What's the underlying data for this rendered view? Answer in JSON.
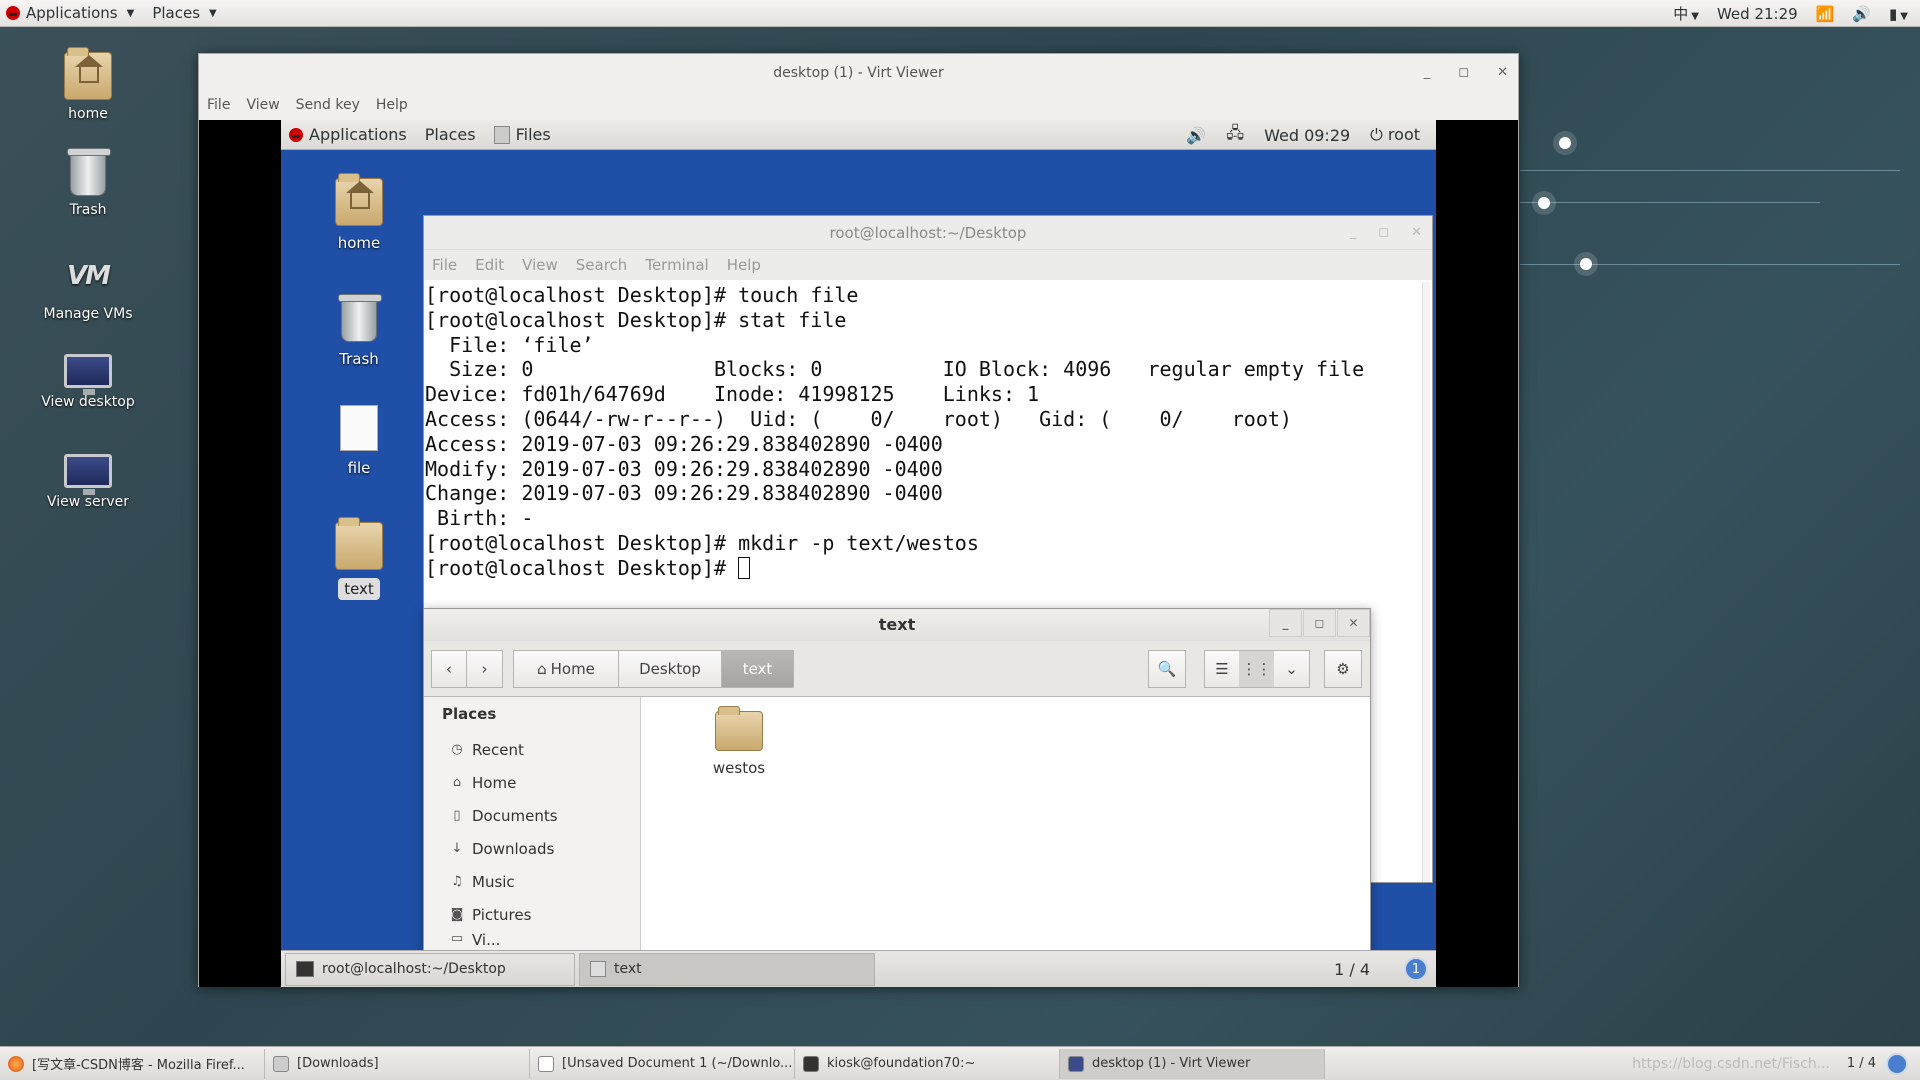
{
  "host": {
    "topbar": {
      "applications": "Applications",
      "places": "Places",
      "input_method": "中",
      "clock": "Wed 21:29"
    },
    "desktop_icons": [
      "home",
      "Trash",
      "Manage VMs",
      "View desktop",
      "View server"
    ],
    "taskbar": [
      "[写文章-CSDN博客 - Mozilla Firef...",
      "[Downloads]",
      "[Unsaved Document 1 (~/Downlo...",
      "kiosk@foundation70:~",
      "desktop (1) - Virt Viewer"
    ],
    "watermark": "https://blog.csdn.net/Fisch...",
    "workspace": "1 / 4"
  },
  "virt_viewer": {
    "title": "desktop (1) - Virt Viewer",
    "menu": [
      "File",
      "View",
      "Send key",
      "Help"
    ]
  },
  "guest": {
    "topbar": {
      "applications": "Applications",
      "places": "Places",
      "files": "Files",
      "clock": "Wed 09:29",
      "user": "root"
    },
    "desktop_icons": [
      "home",
      "Trash",
      "file",
      "text"
    ],
    "terminal": {
      "title": "root@localhost:~/Desktop",
      "menu": [
        "File",
        "Edit",
        "View",
        "Search",
        "Terminal",
        "Help"
      ],
      "lines": [
        "[root@localhost Desktop]# touch file",
        "[root@localhost Desktop]# stat file",
        "  File: ‘file’",
        "  Size: 0               Blocks: 0          IO Block: 4096   regular empty file",
        "Device: fd01h/64769d    Inode: 41998125    Links: 1",
        "Access: (0644/-rw-r--r--)  Uid: (    0/    root)   Gid: (    0/    root)",
        "Access: 2019-07-03 09:26:29.838402890 -0400",
        "Modify: 2019-07-03 09:26:29.838402890 -0400",
        "Change: 2019-07-03 09:26:29.838402890 -0400",
        " Birth: -",
        "[root@localhost Desktop]# mkdir -p text/westos",
        "[root@localhost Desktop]# "
      ]
    },
    "files": {
      "title": "text",
      "breadcrumbs": [
        "Home",
        "Desktop",
        "text"
      ],
      "sidebar_header": "Places",
      "sidebar": [
        "Recent",
        "Home",
        "Documents",
        "Downloads",
        "Music",
        "Pictures",
        "Vi..."
      ],
      "items": [
        "westos"
      ]
    },
    "bottombar": {
      "tasks": [
        "root@localhost:~/Desktop",
        "text"
      ],
      "workspace": "1 / 4",
      "notification_count": "1"
    }
  }
}
